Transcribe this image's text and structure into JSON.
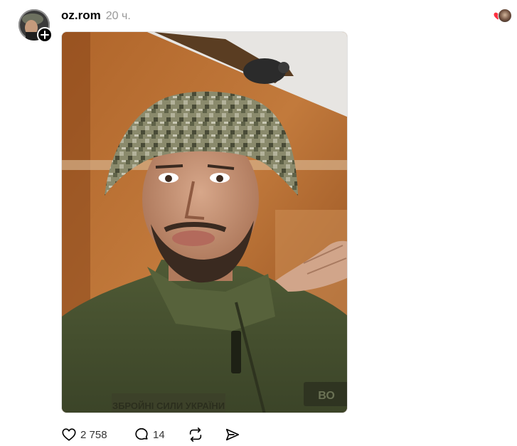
{
  "post": {
    "username": "oz.rom",
    "time_ago": "20 ч.",
    "likes": "2 758",
    "comments": "14"
  },
  "icons": {
    "follow": "plus-icon",
    "reaction": "heart-icon",
    "like": "heart-outline-icon",
    "comment": "speech-bubble-icon",
    "repost": "repost-icon",
    "share": "send-icon"
  },
  "colors": {
    "username": "#000000",
    "timestamp": "#999999",
    "reaction_heart": "#ff3040",
    "action_text": "#333333"
  },
  "photo": {
    "patch_text": "ЗБРОЙНІ СИЛИ УКРАЇНИ",
    "tag_text": "ВО"
  }
}
